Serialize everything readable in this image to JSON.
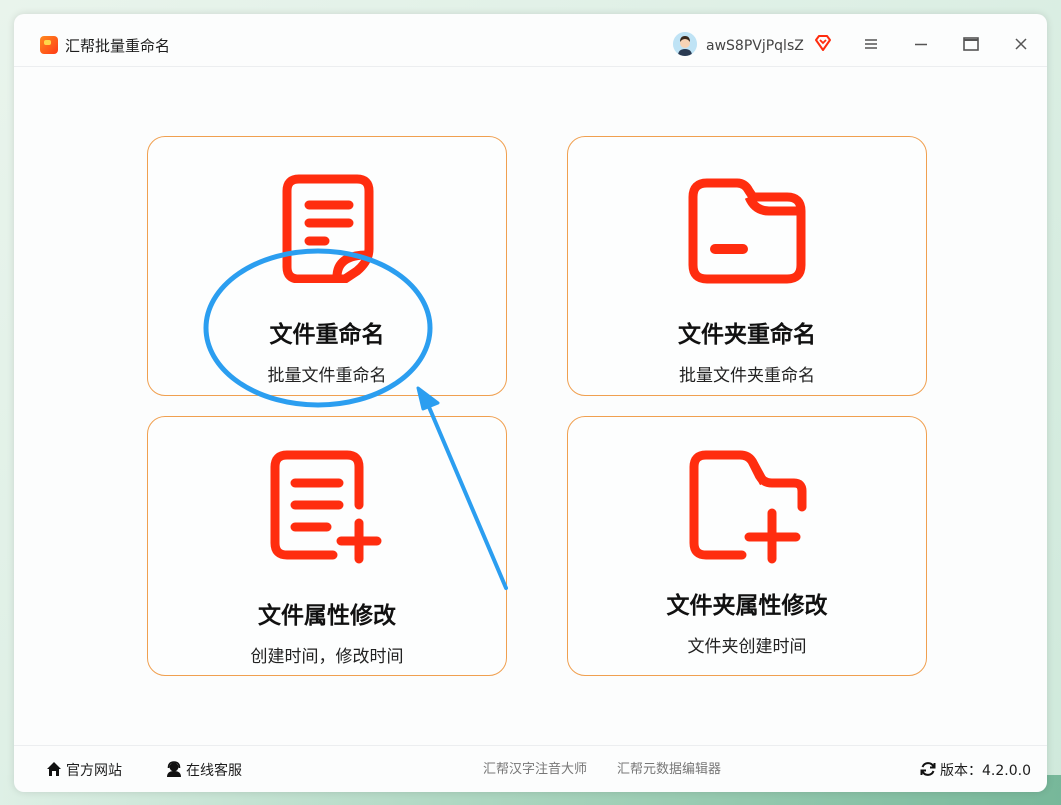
{
  "app": {
    "title": "汇帮批量重命名"
  },
  "user": {
    "name": "awS8PVjPqlsZ"
  },
  "colors": {
    "accent": "#ff2d0f",
    "card_border": "#f0a050",
    "annotation": "#2b9ef0"
  },
  "cards": [
    {
      "title": "文件重命名",
      "subtitle": "批量文件重命名",
      "icon": "document-icon"
    },
    {
      "title": "文件夹重命名",
      "subtitle": "批量文件夹重命名",
      "icon": "folder-icon"
    },
    {
      "title": "文件属性修改",
      "subtitle": "创建时间，修改时间",
      "icon": "document-plus-icon"
    },
    {
      "title": "文件夹属性修改",
      "subtitle": "文件夹创建时间",
      "icon": "folder-plus-icon"
    }
  ],
  "footer": {
    "website": "官方网站",
    "support": "在线客服",
    "link1": "汇帮汉字注音大师",
    "link2": "汇帮元数据编辑器",
    "version": "版本：4.2.0.0"
  }
}
